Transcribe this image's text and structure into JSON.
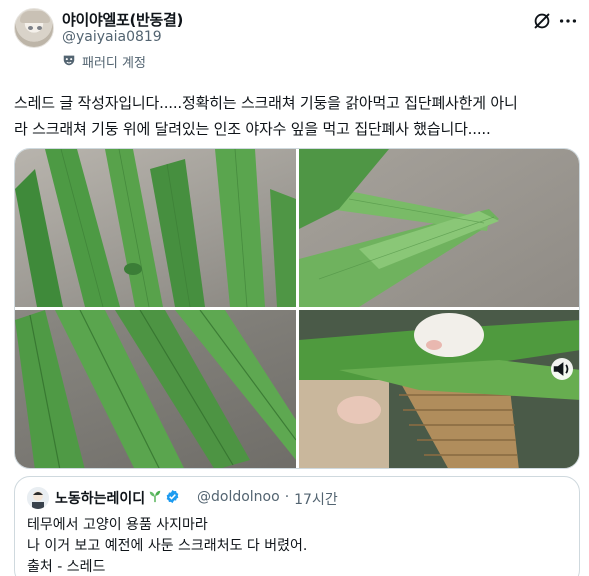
{
  "author": {
    "display_name": "야이야엘포(반동결)",
    "handle": "@yaiyaia0819",
    "label": "패러디 계정",
    "avatar_icon": "avatar-icon",
    "label_icon": "parody-mask-icon"
  },
  "actions": {
    "grok_icon": "grok-icon",
    "more_icon": "more-dots-icon"
  },
  "tweet": {
    "line1": "스레드 글 작성자입니다.....정확히는 스크래쳐 기둥을 갉아먹고 집단폐사한게 아니",
    "line2": "라 스크래쳐 기둥 위에 달려있는 인조 야자수 잎을 먹고 집단폐사 했습니다....."
  },
  "media": {
    "photos": [
      {
        "alt_icon": "palm-leaf-photo"
      },
      {
        "alt_icon": "palm-leaf-closeup-photo"
      },
      {
        "alt_icon": "chewed-leaf-photo"
      },
      {
        "alt_icon": "cat-scratcher-video"
      }
    ],
    "sound_icon": "sound-icon"
  },
  "quote": {
    "name": "노동하는레이디",
    "name_emoji": "seedling-icon",
    "verified_icon": "verified-badge-icon",
    "handle": "@doldolnoo",
    "separator": "·",
    "time": "17시간",
    "lines": [
      "테무에서 고양이 용품 사지마라",
      "나 이거 보고 예전에 사둔 스크래처도 다 버렸어.",
      "출처 - 스레드"
    ]
  },
  "colors": {
    "text_primary": "#0f1419",
    "text_secondary": "#536471",
    "verified": "#1d9bf0",
    "border": "#cfd9de"
  }
}
